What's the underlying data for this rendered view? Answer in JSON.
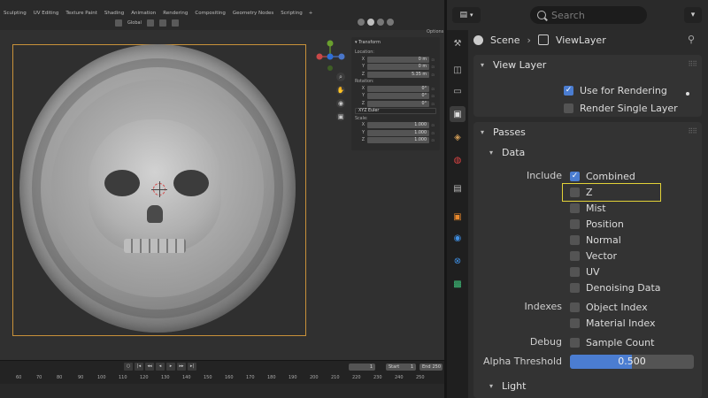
{
  "workspace_tabs": [
    "Sculpting",
    "UV Editing",
    "Texture Paint",
    "Shading",
    "Animation",
    "Rendering",
    "Compositing",
    "Geometry Nodes",
    "Scripting",
    "+"
  ],
  "viewport": {
    "orientation_label": "Global",
    "options_label": "Options",
    "gizmo": {
      "x": "X",
      "y": "Y",
      "z": "Z"
    },
    "n_panel": {
      "title": "Transform",
      "location_label": "Location:",
      "location": [
        {
          "axis": "X",
          "value": "0 m"
        },
        {
          "axis": "Y",
          "value": "0 m"
        },
        {
          "axis": "Z",
          "value": "5.35 m"
        }
      ],
      "rotation_label": "Rotation:",
      "rotation": [
        {
          "axis": "X",
          "value": "0°"
        },
        {
          "axis": "Y",
          "value": "0°"
        },
        {
          "axis": "Z",
          "value": "0°"
        }
      ],
      "rotation_mode": "XYZ Euler",
      "scale_label": "Scale:",
      "scale": [
        {
          "axis": "X",
          "value": "1.000"
        },
        {
          "axis": "Y",
          "value": "1.000"
        },
        {
          "axis": "Z",
          "value": "1.000"
        }
      ]
    }
  },
  "timeline": {
    "current_frame": "1",
    "start_label": "Start",
    "start_value": "1",
    "end_label": "End",
    "end_value": "250",
    "ruler": [
      "60",
      "70",
      "80",
      "90",
      "100",
      "110",
      "120",
      "130",
      "140",
      "150",
      "160",
      "170",
      "180",
      "190",
      "200",
      "210",
      "220",
      "230",
      "240",
      "250"
    ]
  },
  "properties": {
    "search_placeholder": "Search",
    "breadcrumb": {
      "scene": "Scene",
      "separator": "›",
      "view_layer": "ViewLayer"
    },
    "view_layer_panel": {
      "title": "View Layer",
      "use_for_rendering": {
        "label": "Use for Rendering",
        "checked": true
      },
      "render_single_layer": {
        "label": "Render Single Layer",
        "checked": false
      }
    },
    "passes_panel": {
      "title": "Passes",
      "data_title": "Data",
      "include_label": "Include",
      "include": [
        {
          "label": "Combined",
          "checked": true
        },
        {
          "label": "Z",
          "checked": false
        },
        {
          "label": "Mist",
          "checked": false
        },
        {
          "label": "Position",
          "checked": false
        },
        {
          "label": "Normal",
          "checked": false
        },
        {
          "label": "Vector",
          "checked": false
        },
        {
          "label": "UV",
          "checked": false
        },
        {
          "label": "Denoising Data",
          "checked": false
        }
      ],
      "indexes_label": "Indexes",
      "indexes": [
        {
          "label": "Object Index",
          "checked": false
        },
        {
          "label": "Material Index",
          "checked": false
        }
      ],
      "debug_label": "Debug",
      "debug": [
        {
          "label": "Sample Count",
          "checked": false
        }
      ],
      "alpha_threshold_label": "Alpha Threshold",
      "alpha_threshold_value": "0.500",
      "alpha_threshold_fraction": 0.5
    },
    "light_panel": {
      "title": "Light"
    }
  },
  "colors": {
    "accent_blue": "#4b7dd1",
    "highlight_yellow": "#e2d238",
    "camera_frame": "#c8913a"
  },
  "icons": [
    "search-icon",
    "pin-icon",
    "editor-type-icon",
    "tool-tab-icon",
    "render-tab-icon",
    "output-tab-icon",
    "view-layer-tab-icon",
    "scene-tab-icon",
    "world-tab-icon",
    "collection-tab-icon",
    "object-tab-icon",
    "modifier-tab-icon",
    "physics-tab-icon",
    "constraint-tab-icon",
    "data-tab-icon",
    "checkmark-icon"
  ]
}
